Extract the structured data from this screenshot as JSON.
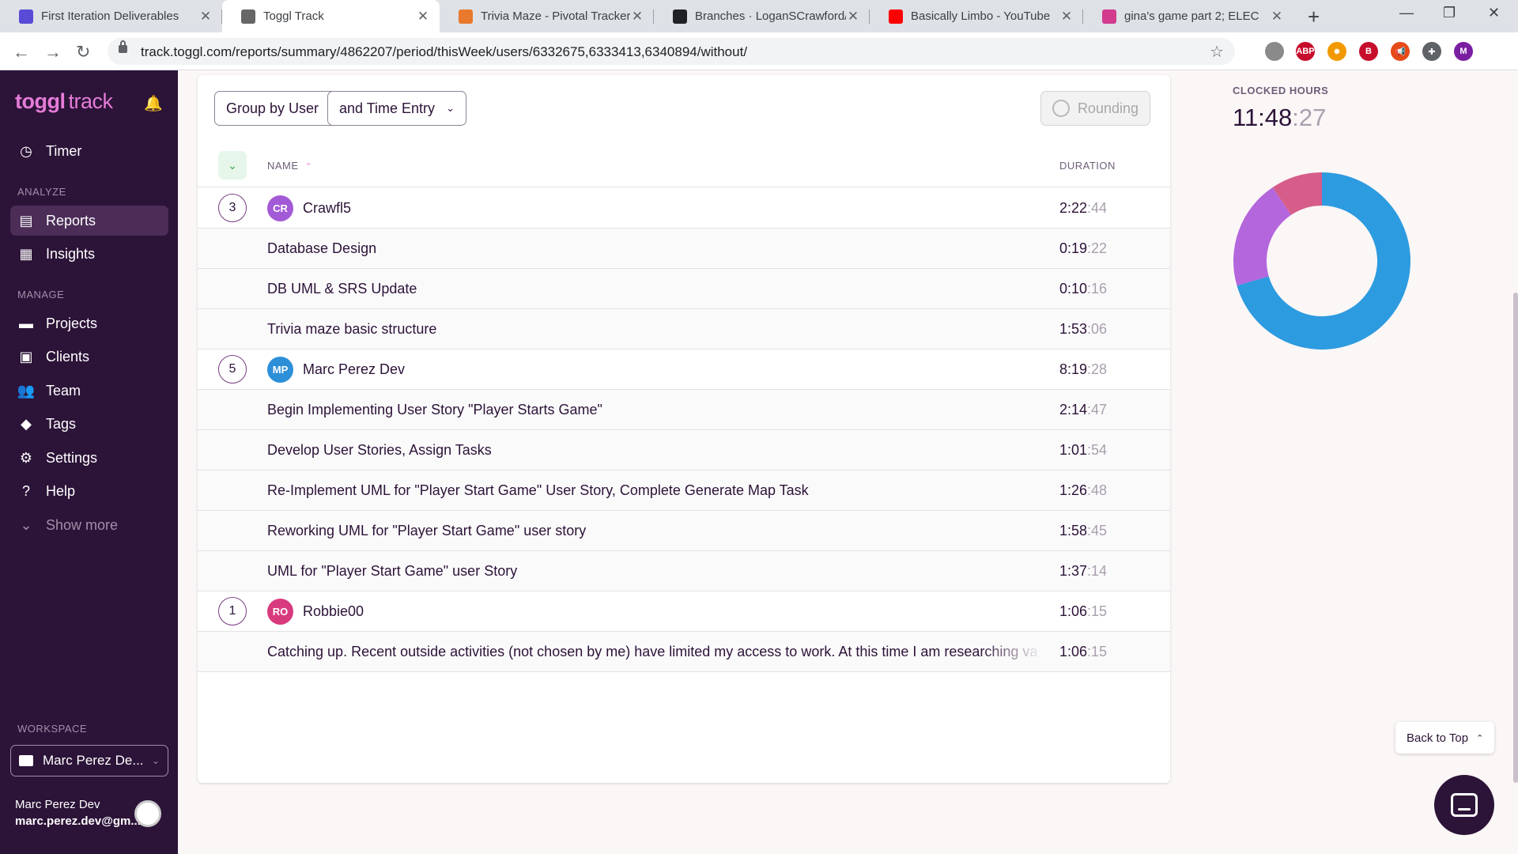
{
  "browser": {
    "tabs": [
      {
        "title": "First Iteration Deliverables",
        "icon": "w-icon",
        "color": "#5a4bd6"
      },
      {
        "title": "Toggl Track",
        "icon": "toggl-icon",
        "color": "#666666",
        "active": true
      },
      {
        "title": "Trivia Maze - Pivotal Tracker",
        "icon": "pivotal-icon",
        "color": "#e97a2d"
      },
      {
        "title": "Branches · LoganSCrawford/",
        "icon": "github-icon",
        "color": "#202124"
      },
      {
        "title": "Basically Limbo - YouTube",
        "icon": "youtube-icon",
        "color": "#ff0000"
      },
      {
        "title": "gina's game part 2; ELEC",
        "icon": "game-icon",
        "color": "#d23b8e"
      }
    ],
    "url": "track.toggl.com/reports/summary/4862207/period/thisWeek/users/6332675,6333413,6340894/without/",
    "extensions": [
      {
        "name": "cube-icon",
        "label": "",
        "color": "#8a8a8a"
      },
      {
        "name": "adblock-icon",
        "label": "ABP",
        "color": "#c70d2c"
      },
      {
        "name": "sun-icon",
        "label": "✹",
        "color": "#f29900"
      },
      {
        "name": "shield-b-icon",
        "label": "B",
        "color": "#c70d2c"
      },
      {
        "name": "megaphone-icon",
        "label": "📢",
        "color": "#e64a19"
      },
      {
        "name": "puzzle-icon",
        "label": "✚",
        "color": "#5f6368"
      },
      {
        "name": "profile-icon",
        "label": "M",
        "color": "#7b1fa2"
      }
    ]
  },
  "sidebar": {
    "logo_main": "toggl",
    "logo_sub": "track",
    "timer": "Timer",
    "analyze_label": "ANALYZE",
    "reports": "Reports",
    "insights": "Insights",
    "manage_label": "MANAGE",
    "projects": "Projects",
    "clients": "Clients",
    "team": "Team",
    "tags": "Tags",
    "settings": "Settings",
    "help": "Help",
    "show_more": "Show more",
    "workspace_label": "WORKSPACE",
    "workspace_name": "Marc Perez De...",
    "user_name": "Marc Perez Dev",
    "user_email": "marc.perez.dev@gm..."
  },
  "toolbar": {
    "group_by": "Group by User",
    "sub_group": "and Time Entry",
    "rounding": "Rounding"
  },
  "table": {
    "col_name": "NAME",
    "col_duration": "DURATION",
    "rows": [
      {
        "kind": "user",
        "count": "3",
        "initials": "CR",
        "avatar_color": "#a35ad6",
        "name": "Crawfl5",
        "dur_main": "2:22",
        "dur_sec": ":44"
      },
      {
        "kind": "entry",
        "name": "Database Design",
        "dur_main": "0:19",
        "dur_sec": ":22"
      },
      {
        "kind": "entry",
        "name": "DB UML & SRS Update",
        "dur_main": "0:10",
        "dur_sec": ":16"
      },
      {
        "kind": "entry",
        "name": "Trivia maze basic structure",
        "dur_main": "1:53",
        "dur_sec": ":06"
      },
      {
        "kind": "user",
        "count": "5",
        "initials": "MP",
        "avatar_color": "#2d8fd8",
        "name": "Marc Perez Dev",
        "dur_main": "8:19",
        "dur_sec": ":28"
      },
      {
        "kind": "entry",
        "name": "Begin Implementing User Story \"Player Starts Game\"",
        "dur_main": "2:14",
        "dur_sec": ":47"
      },
      {
        "kind": "entry",
        "name": "Develop User Stories, Assign Tasks",
        "dur_main": "1:01",
        "dur_sec": ":54"
      },
      {
        "kind": "entry",
        "name": "Re-Implement UML for \"Player Start Game\" User Story, Complete Generate Map Task",
        "dur_main": "1:26",
        "dur_sec": ":48"
      },
      {
        "kind": "entry",
        "name": "Reworking UML for \"Player Start Game\" user story",
        "dur_main": "1:58",
        "dur_sec": ":45"
      },
      {
        "kind": "entry",
        "name": "UML for \"Player Start Game\" user Story",
        "dur_main": "1:37",
        "dur_sec": ":14"
      },
      {
        "kind": "user",
        "count": "1",
        "initials": "RO",
        "avatar_color": "#d83a7e",
        "name": "Robbie00",
        "dur_main": "1:06",
        "dur_sec": ":15"
      },
      {
        "kind": "entry",
        "name": "Catching up. Recent outside activities (not chosen by me) have limited my access to work.  At this time I am researching va",
        "dur_main": "1:06",
        "dur_sec": ":15"
      }
    ]
  },
  "summary": {
    "clocked_label": "CLOCKED HOURS",
    "clocked_main": "11:48",
    "clocked_sec": ":27"
  },
  "donut": {
    "segments": [
      {
        "name": "Marc Perez Dev",
        "color": "#2d9be0",
        "fraction": 0.7051
      },
      {
        "name": "Crawfl5",
        "color": "#b467dc",
        "fraction": 0.2009
      },
      {
        "name": "Robbie00",
        "color": "#d65d8a",
        "fraction": 0.094
      }
    ]
  },
  "back_to_top": "Back to Top"
}
